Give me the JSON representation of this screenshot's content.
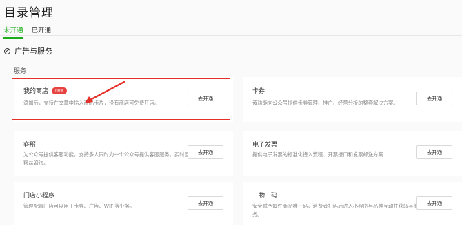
{
  "page": {
    "title": "目录管理"
  },
  "tabs": [
    {
      "label": "未开通",
      "active": true
    },
    {
      "label": "已开通",
      "active": false
    }
  ],
  "section": {
    "title": "广告与服务",
    "subtitle": "服务"
  },
  "cards": [
    {
      "name": "我的商店",
      "badge": "new",
      "desc": "添加后，支持在文章中插入商品卡片，没有商店可免费开店。",
      "button": "去开通"
    },
    {
      "name": "卡券",
      "desc": "该功能向公众号提供卡券管理、推广、经营分析的整套解决方案。",
      "button": "去开通"
    },
    {
      "name": "客服",
      "desc": "为公众号提供客服功能，支持多人同时为一个公众号提供客服服务，实时回复粉丝咨询。",
      "button": "去开通"
    },
    {
      "name": "电子发票",
      "desc": "提供电子发票的标准化接入流程、开票接口和发票邮送方案",
      "button": "去开通"
    },
    {
      "name": "门店小程序",
      "desc": "管理配置门店可以用于卡券、广告、WIFI等业务。",
      "button": "去开通"
    },
    {
      "name": "一物一码",
      "desc": "安全赋予每件商品唯一码，消费者扫码后进入小程序与品牌互动并获取其他服务。",
      "button": "去开通"
    }
  ],
  "colors": {
    "accent": "#1aad19",
    "annotation": "#e5302a",
    "badge": "#e64340"
  }
}
